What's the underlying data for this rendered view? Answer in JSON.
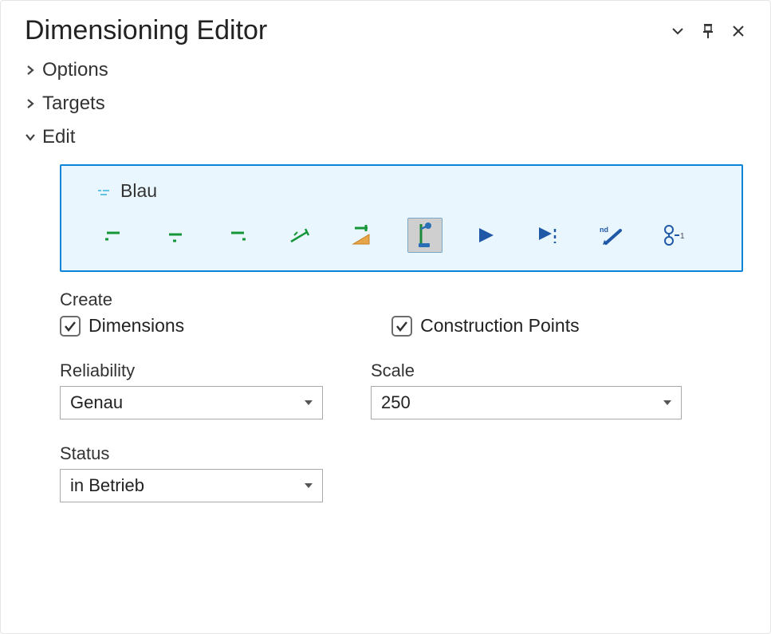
{
  "panel": {
    "title": "Dimensioning Editor"
  },
  "sections": {
    "options": {
      "label": "Options",
      "expanded": false
    },
    "targets": {
      "label": "Targets",
      "expanded": false
    },
    "edit": {
      "label": "Edit",
      "expanded": true
    }
  },
  "edit": {
    "style_name": "Blau",
    "tools": [
      {
        "id": "dim-baseline-1",
        "selected": false
      },
      {
        "id": "dim-baseline-2",
        "selected": false
      },
      {
        "id": "dim-baseline-3",
        "selected": false
      },
      {
        "id": "dim-angle",
        "selected": false
      },
      {
        "id": "dim-slope",
        "selected": false
      },
      {
        "id": "dim-vertical",
        "selected": true
      },
      {
        "id": "marker-point",
        "selected": false
      },
      {
        "id": "marker-point-dashed",
        "selected": false
      },
      {
        "id": "edit-label",
        "selected": false
      },
      {
        "id": "edit-node",
        "selected": false
      }
    ],
    "create_label": "Create",
    "checkboxes": {
      "dimensions": {
        "label": "Dimensions",
        "checked": true
      },
      "construction_points": {
        "label": "Construction Points",
        "checked": true
      }
    },
    "fields": {
      "reliability": {
        "label": "Reliability",
        "value": "Genau"
      },
      "scale": {
        "label": "Scale",
        "value": "250"
      },
      "status": {
        "label": "Status",
        "value": "in Betrieb"
      }
    }
  }
}
